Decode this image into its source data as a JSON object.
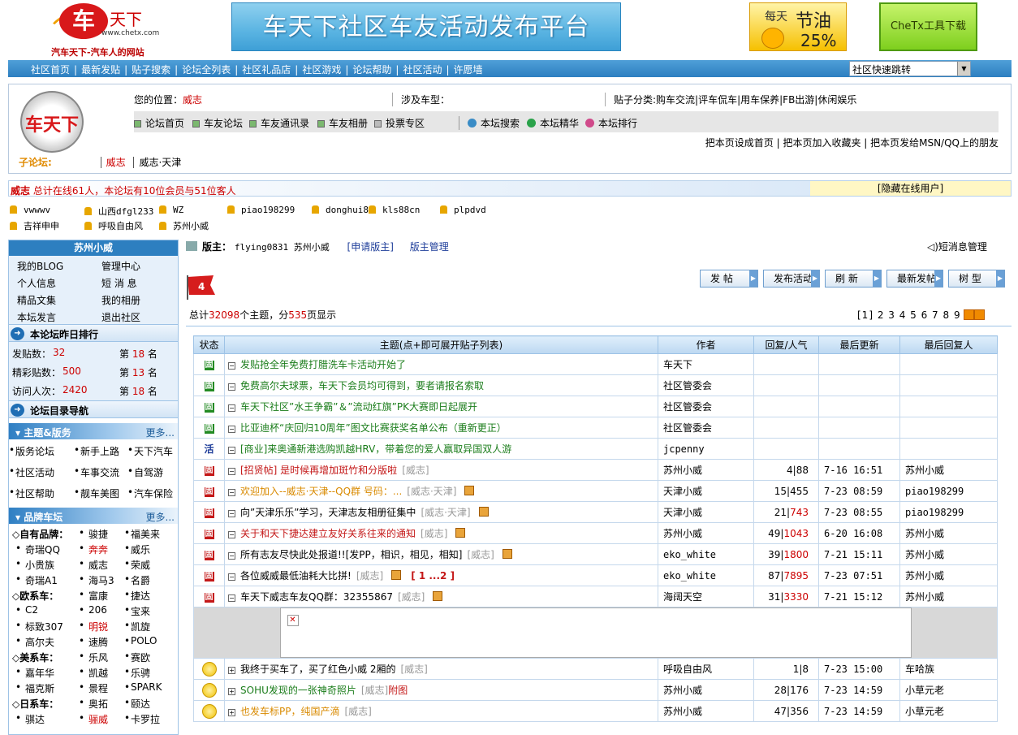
{
  "header": {
    "logo_text": "车天下",
    "logo_url": "www.chetx.com",
    "logo_slogan": "汽车天下-汽车人的网站",
    "banner_text": "车天下社区车友活动发布平台",
    "ad1_a": "每天",
    "ad1_b": "节油",
    "ad1_c": "25%",
    "ad2": "CheTx工具下载"
  },
  "topnav": {
    "items": [
      "社区首页",
      "最新发贴",
      "贴子搜索",
      "论坛全列表",
      "社区礼品店",
      "社区游戏",
      "论坛帮助",
      "社区活动",
      "许愿墙"
    ],
    "jump": "社区快速跳转"
  },
  "info": {
    "location_label": "您的位置：",
    "location_value": "威志",
    "car_label": "涉及车型：",
    "cat_label": "贴子分类:",
    "cats": "购车交流|评车侃车|用车保养|FB出游|休闲娱乐",
    "nav1": [
      "论坛首页",
      "车友论坛",
      "车友通讯录",
      "车友相册",
      "投票专区"
    ],
    "nav2": [
      "本坛搜索",
      "本坛精华",
      "本坛排行"
    ],
    "set_links": "把本页设成首页 | 把本页加入收藏夹 | 把本页发给MSN/QQ上的朋友",
    "subforum_label": "子论坛:",
    "subforum_a": "威志",
    "subforum_b": "威志·天津",
    "biglogo": "车天下"
  },
  "online": {
    "forum": "威志",
    "text": "总计在线61人，本论坛有10位会员与51位客人",
    "hide": "[隐藏在线用户]",
    "users_row1": [
      "vwwwv",
      "山西dfgl233",
      "WZ",
      "piao198299",
      "donghui8",
      "kls88cn",
      "plpdvd"
    ],
    "users_row2": [
      "吉祥申申",
      "呼吸自由风",
      "苏州小威"
    ]
  },
  "sidebar": {
    "title": "苏州小威",
    "links": [
      "我的BLOG",
      "管理中心",
      "个人信息",
      "短 消 息",
      "精品文集",
      "我的相册",
      "本坛发言",
      "退出社区"
    ],
    "rank_title": "本论坛昨日排行",
    "rank": [
      {
        "l": "发贴数：",
        "v": "32",
        "r": "第 18 名",
        "rn": "18"
      },
      {
        "l": "精彩贴数：",
        "v": "500",
        "r": "第 13 名",
        "rn": "13"
      },
      {
        "l": "访问人次：",
        "v": "2420",
        "r": "第 18 名",
        "rn": "18"
      }
    ],
    "nav_title": "论坛目录导航",
    "sec1": "主题&版务",
    "more": "更多...",
    "sec1_rows": [
      [
        "版务论坛",
        "新手上路",
        "天下汽车"
      ],
      [
        "社区活动",
        "车事交流",
        "自驾游"
      ],
      [
        "社区帮助",
        "靓车美图",
        "汽车保险"
      ]
    ],
    "sec2": "品牌车坛",
    "brand_rows": [
      [
        "◇自有品牌：",
        "骏捷",
        "福美来"
      ],
      [
        "奇瑞QQ",
        "奔奔",
        "威乐"
      ],
      [
        "小贵族",
        "威志",
        "荣威"
      ],
      [
        "奇瑞A1",
        "海马3",
        "名爵"
      ],
      [
        "◇欧系车：",
        "富康",
        "捷达"
      ],
      [
        "C2",
        "206",
        "宝来"
      ],
      [
        "标致307",
        "明锐",
        "凯旋"
      ],
      [
        "高尔夫",
        "速腾",
        "POLO"
      ],
      [
        "◇美系车：",
        "乐风",
        "赛欧"
      ],
      [
        "嘉年华",
        "凯越",
        "乐骋"
      ],
      [
        "福克斯",
        "景程",
        "SPARK"
      ],
      [
        "◇日系车：",
        "奥拓",
        "颐达"
      ],
      [
        "骐达",
        "骊威",
        "卡罗拉"
      ]
    ]
  },
  "main": {
    "mod_label": "版主：",
    "mods": "flying0831   苏州小威",
    "apply": "[申请版主]",
    "manage": "版主管理",
    "sms": "短消息管理",
    "flag": "4",
    "buttons": [
      "发 帖",
      "发布活动",
      "刷 新",
      "最新发帖",
      "树 型"
    ],
    "total_a": "总计",
    "total_n": "32098",
    "total_b": "个主题，分",
    "total_p": "535",
    "total_c": "页显示",
    "pages": "[1] 2 3 4 5 6 7 8 9"
  },
  "table": {
    "headers": [
      "状态",
      "主题(点+即可展开贴子列表)",
      "作者",
      "回复/人气",
      "最后更新",
      "最后回复人"
    ],
    "rows": [
      {
        "s": "固",
        "sc": "g",
        "t": "发贴抢全年免费打腊洗车卡活动开始了",
        "tc": "gt",
        "f": "",
        "a": "车天下",
        "r": "",
        "u": "",
        "l": ""
      },
      {
        "s": "固",
        "sc": "g",
        "t": "免费高尔夫球票，车天下会员均可得到，要者请报名索取",
        "tc": "gt",
        "f": "",
        "a": "社区管委会",
        "r": "",
        "u": "",
        "l": ""
      },
      {
        "s": "固",
        "sc": "g",
        "t": "车天下社区”水王争霸”＆”流动红旗”PK大赛即日起展开",
        "tc": "gt",
        "f": "",
        "a": "社区管委会",
        "r": "",
        "u": "",
        "l": ""
      },
      {
        "s": "固",
        "sc": "g",
        "t": "比亚迪杯“庆回归10周年”图文比赛获奖名单公布（重新更正）",
        "tc": "gt",
        "f": "",
        "a": "社区管委会",
        "r": "",
        "u": "",
        "l": ""
      },
      {
        "s": "活",
        "sc": "h",
        "t": "[商业]来奥通新港选购凯越HRV，带着您的爱人赢取异国双人游",
        "tc": "gt",
        "f": "",
        "a": "jcpenny",
        "r": "",
        "u": "",
        "l": ""
      },
      {
        "s": "固",
        "sc": "r",
        "t": "[招贤帖] 是时候再增加斑竹和分版啦",
        "tc": "rt",
        "f": "[威志]",
        "a": "苏州小威",
        "r": "4|88",
        "u": "7-16 16:51",
        "l": "苏州小威"
      },
      {
        "s": "固",
        "sc": "r",
        "t": "欢迎加入--威志·天津--QQ群 号码：...",
        "tc": "ot",
        "f": "[威志·天津]",
        "a": "天津小威",
        "r": "15|455",
        "u": "7-23 08:59",
        "l": "piao198299"
      },
      {
        "s": "固",
        "sc": "r",
        "t": "向”天津乐乐”学习，天津志友相册征集中",
        "tc": "dk",
        "f": "[威志·天津]",
        "a": "天津小威",
        "r": "21|743",
        "u": "7-23 08:55",
        "l": "piao198299"
      },
      {
        "s": "固",
        "sc": "r",
        "t": "关于和天下捷达建立友好关系往来的通知",
        "tc": "rt",
        "f": "[威志]",
        "a": "苏州小威",
        "r": "49|1043",
        "u": "6-20 16:08",
        "l": "苏州小威"
      },
      {
        "s": "固",
        "sc": "r",
        "t": "所有志友尽快此处报道!![发PP，相识，相见，相知]",
        "tc": "dk",
        "f": "[威志]",
        "a": "eko_white",
        "r": "39|1800",
        "u": "7-21 15:11",
        "l": "苏州小威"
      },
      {
        "s": "固",
        "sc": "r",
        "t": "各位威威最低油耗大比拼!",
        "tc": "dk",
        "f": "[威志]",
        "a": "eko_white",
        "r": "87|7895",
        "u": "7-23 07:51",
        "l": "苏州小威",
        "extra": "[ 1 ...2 ]"
      },
      {
        "s": "固",
        "sc": "r",
        "t": "车天下威志车友QQ群：32355867",
        "tc": "dk",
        "f": "[威志]",
        "a": "海阔天空",
        "r": "31|3330",
        "u": "7-21 15:12",
        "l": "苏州小威"
      }
    ],
    "rows2": [
      {
        "t": "我终于买车了，买了红色小威 2厢的",
        "tc": "dk",
        "f": "[威志]",
        "a": "呼吸自由风",
        "r": "1|8",
        "u": "7-23 15:00",
        "l": "车哈族"
      },
      {
        "t": "SOHU发现的一张神奇照片",
        "tc": "gt",
        "f": "[威志]",
        "x": "附图",
        "a": "苏州小威",
        "r": "28|176",
        "u": "7-23 14:59",
        "l": "小草元老"
      },
      {
        "t": "也发车标PP，纯国产滴",
        "tc": "ot",
        "f": "[威志]",
        "a": "苏州小威",
        "r": "47|356",
        "u": "7-23 14:59",
        "l": "小草元老"
      }
    ]
  },
  "colors": {
    "nav_blue": "#2d7fc0",
    "red": "#c41818",
    "green": "#238b23",
    "orange": "#d98a00"
  }
}
